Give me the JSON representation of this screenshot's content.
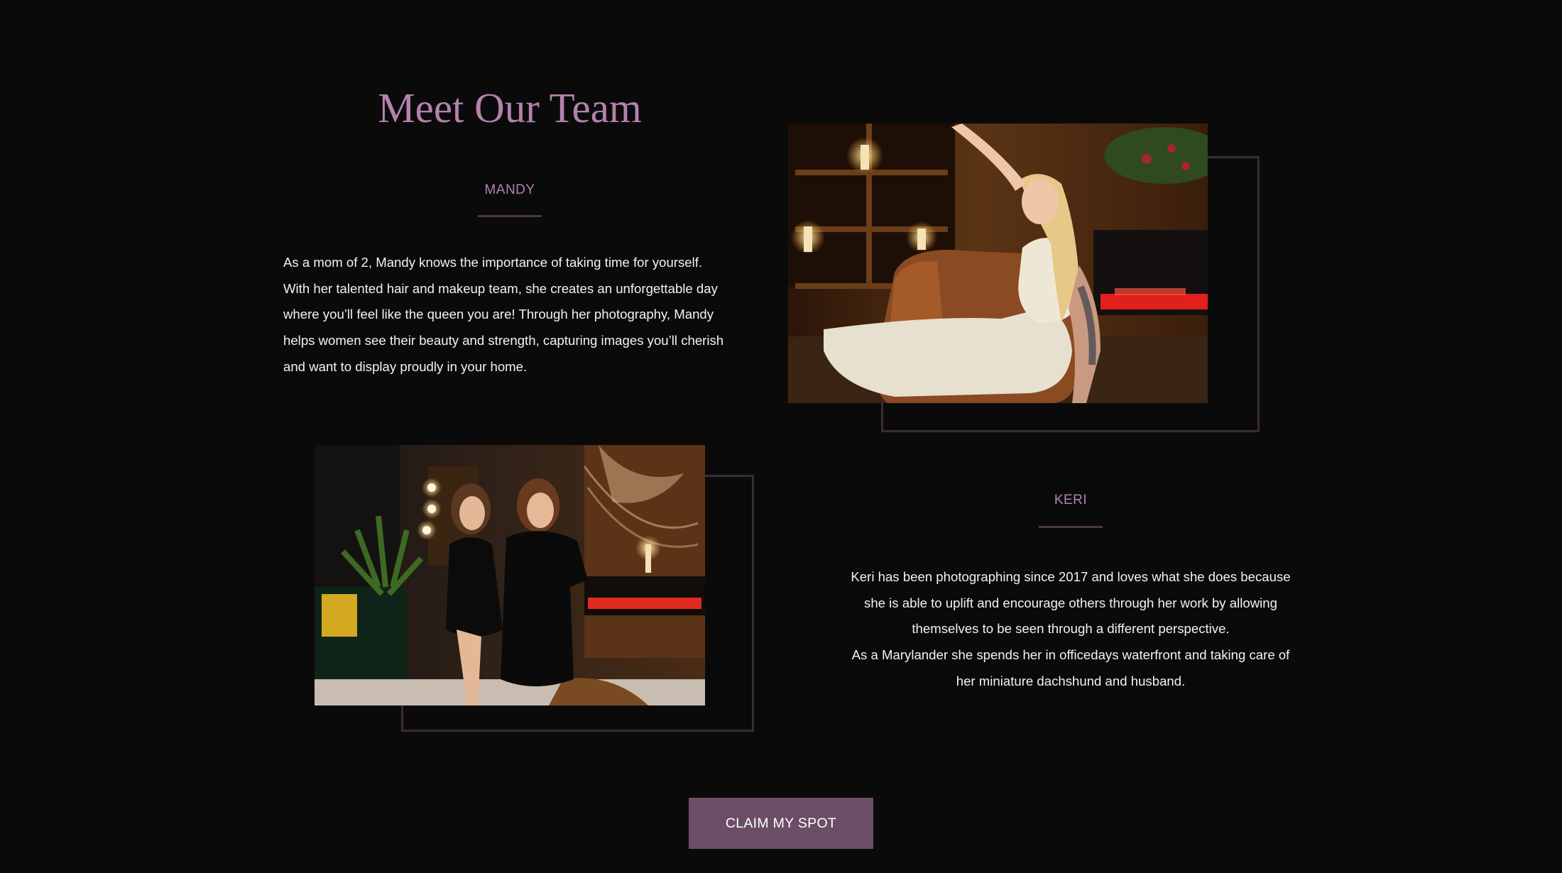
{
  "section": {
    "title": "Meet Our Team"
  },
  "members": [
    {
      "name": "MANDY",
      "bio_lines": [
        "As a mom of 2, Mandy knows the importance of taking time for yourself.",
        "With her talented hair and makeup team, she creates an unforgettable day",
        "where you’ll feel like the queen you are! Through her photography, Mandy",
        "helps women see their beauty and strength, capturing images you’ll cherish",
        "and want to display proudly in your home."
      ]
    },
    {
      "name": "KERI",
      "bio_lines": [
        "Keri has been photographing since 2017 and loves what she does because",
        "she is able to uplift and encourage others through her work by allowing",
        "themselves to be seen through a different perspective.",
        "As a Marylander she spends her in officedays waterfront and taking care of",
        "her miniature dachshund and husband."
      ]
    }
  ],
  "cta": {
    "label": "CLAIM MY SPOT"
  },
  "colors": {
    "background": "#0b0a0b",
    "accent": "#b382ad",
    "button": "#6b4e66",
    "frame": "#3a2a37"
  }
}
